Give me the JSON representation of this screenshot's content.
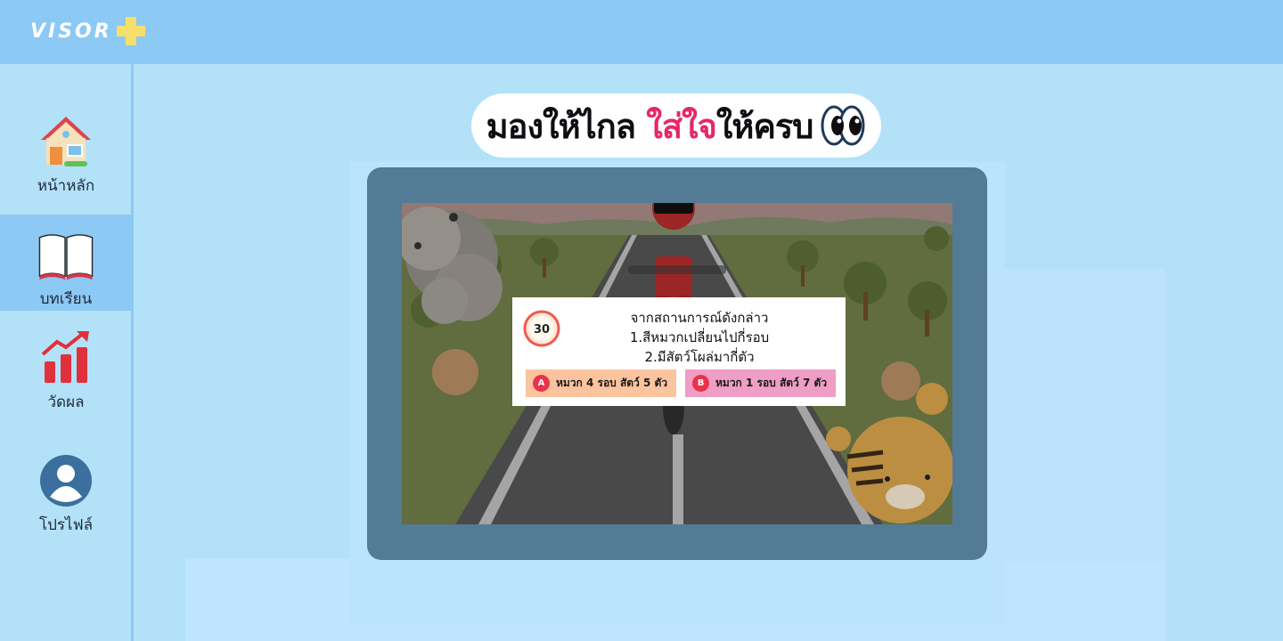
{
  "app": {
    "logo_text": "VISOR"
  },
  "sidebar": {
    "items": [
      {
        "label": "หน้าหลัก",
        "icon": "house-icon"
      },
      {
        "label": "บทเรียน",
        "icon": "open-book-icon",
        "active": true
      },
      {
        "label": "วัดผล",
        "icon": "bar-chart-trend-icon"
      },
      {
        "label": "โปรไฟล์",
        "icon": "user-avatar-icon"
      }
    ]
  },
  "header": {
    "title_part1": "มองให้ไกล ",
    "title_accent": "ใส่ใจ",
    "title_part2": "ให้ครบ"
  },
  "quiz": {
    "timer": "30",
    "lines": [
      "จากสถานการณ์ดังกล่าว",
      "1.สีหมวกเปลี่ยนไปกี่รอบ",
      "2.มีสัตว์โผล่มากี่ตัว"
    ],
    "options": [
      {
        "key": "A",
        "label": "หมวก 4 รอบ สัตว์ 5 ตัว"
      },
      {
        "key": "B",
        "label": "หมวก 1 รอบ สัตว์ 7 ตัว"
      }
    ]
  },
  "colors": {
    "topbar": "#8cc9f5",
    "background": "#b3e2f8",
    "accent": "#e5286a",
    "option_a": "#fcc49e",
    "option_b": "#ef9ec6"
  }
}
